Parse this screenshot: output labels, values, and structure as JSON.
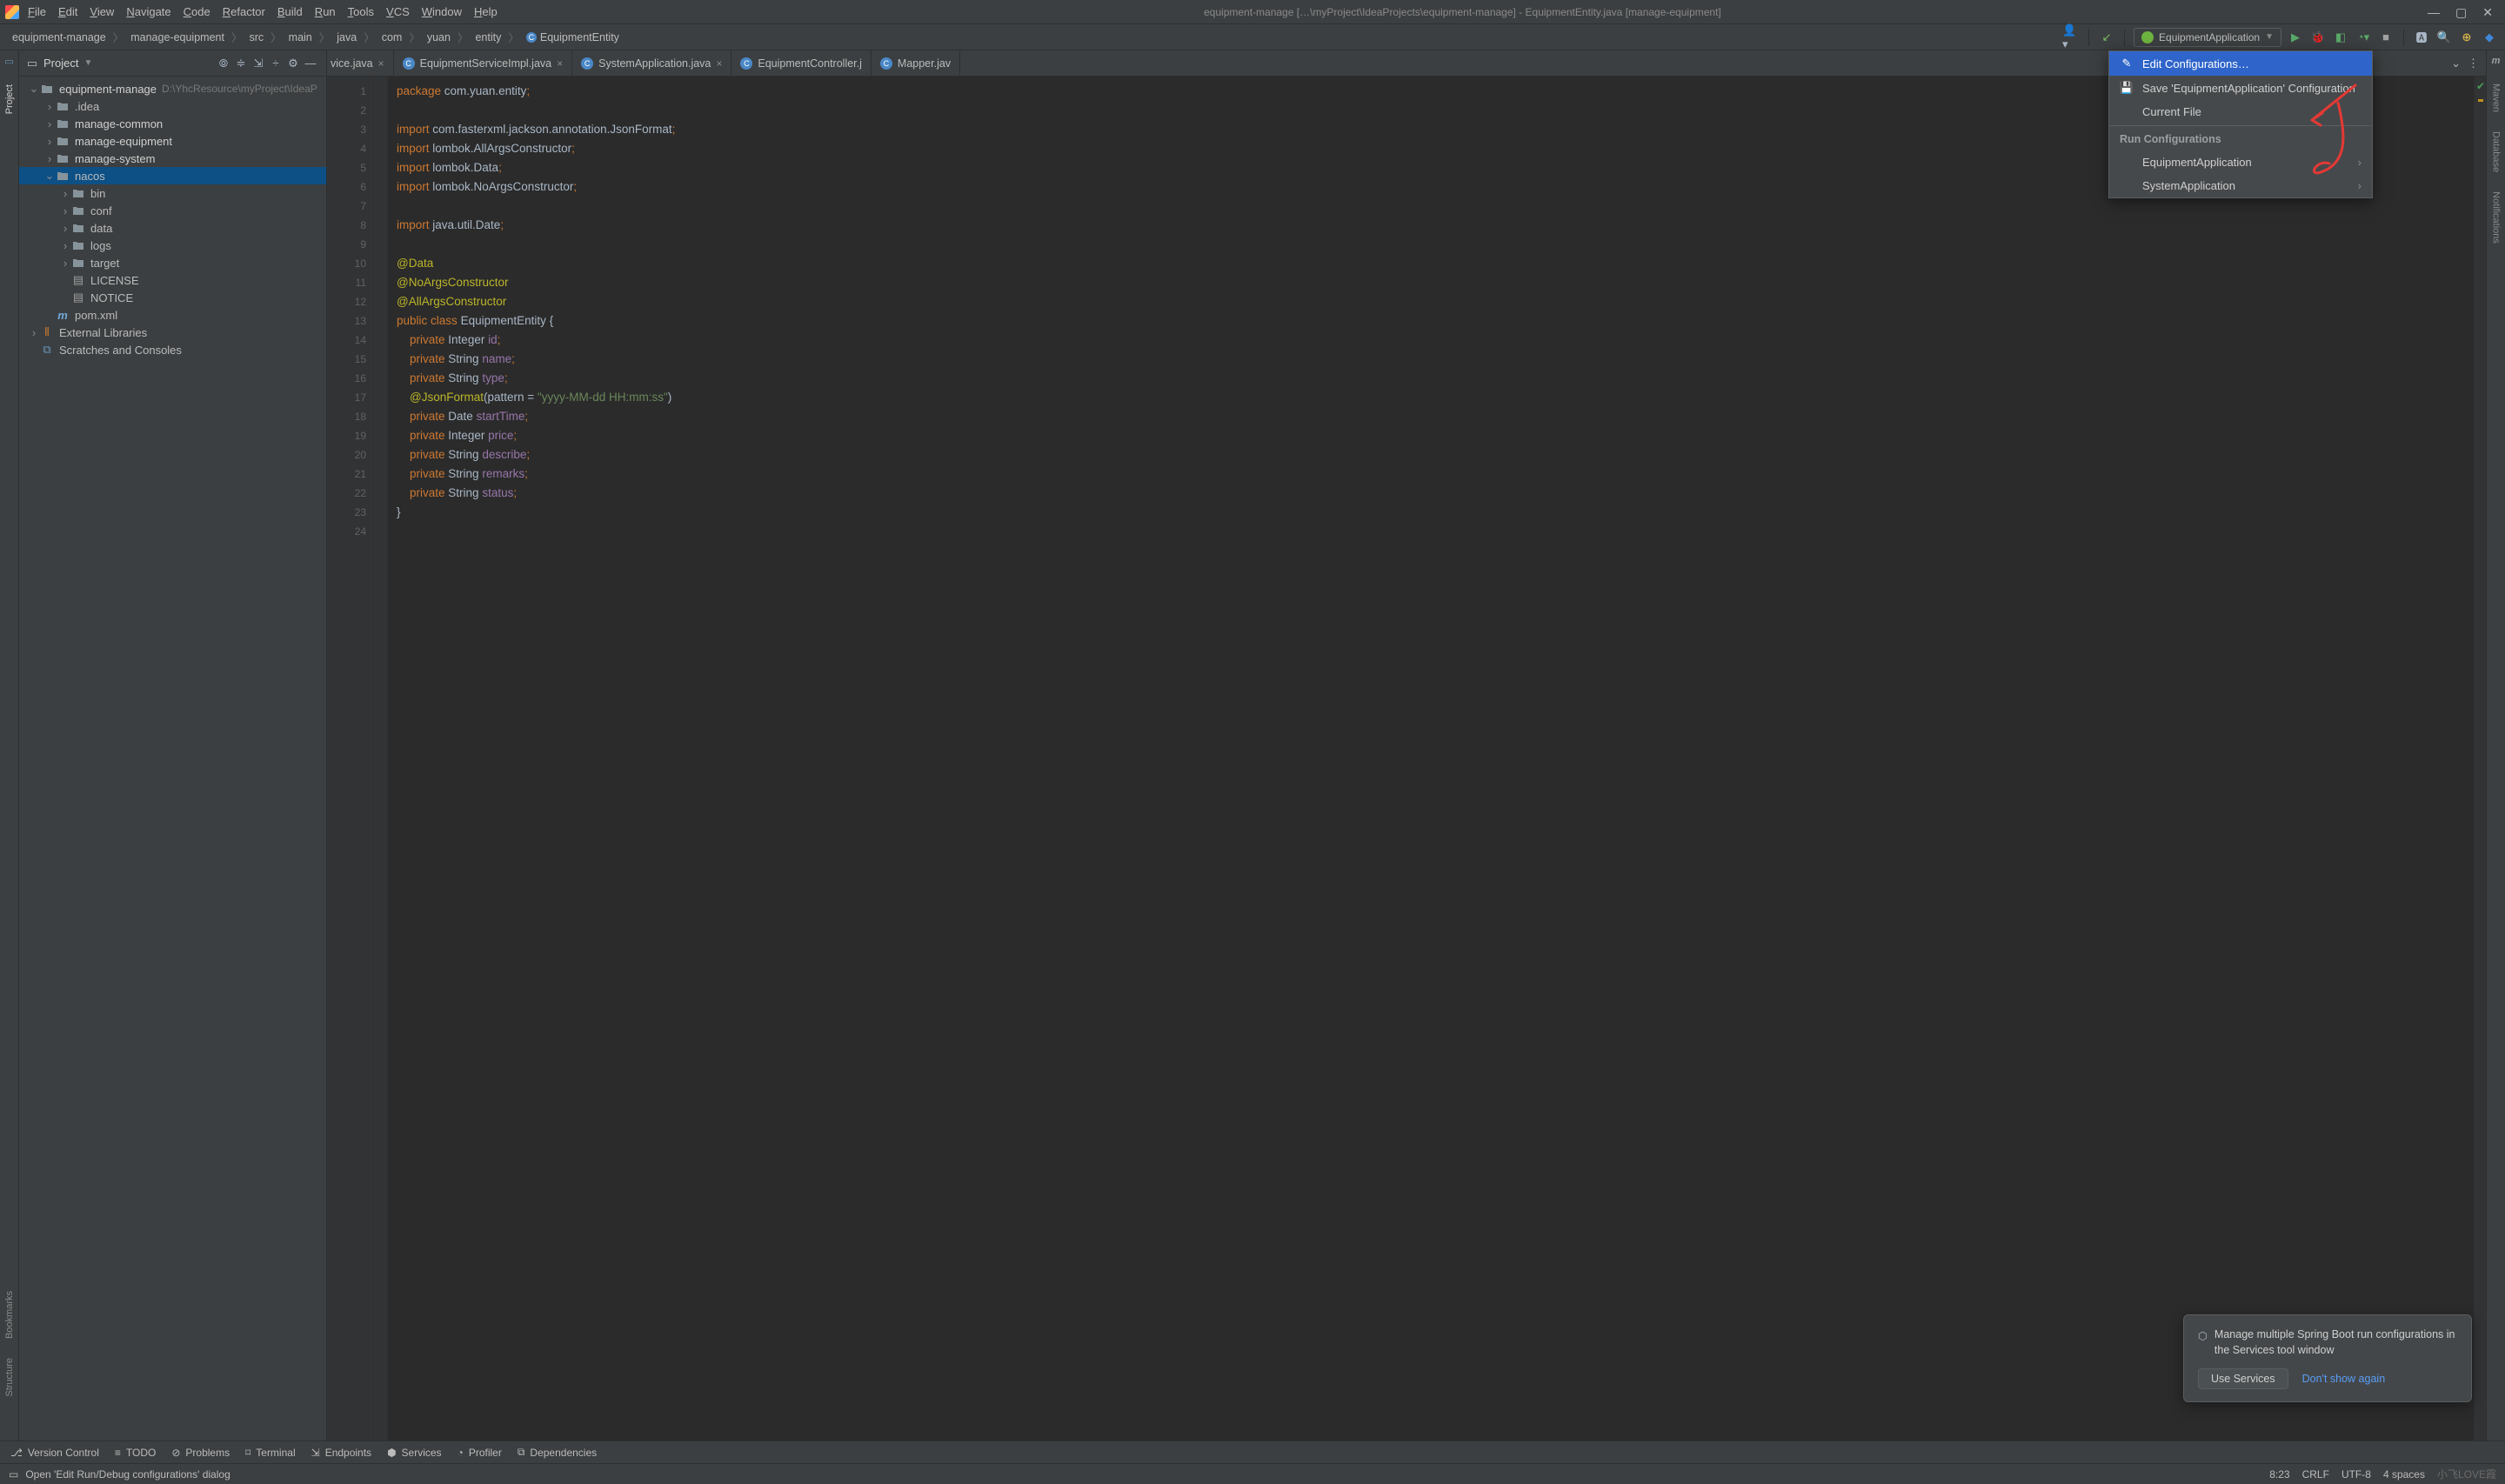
{
  "window": {
    "title": "equipment-manage […\\myProject\\IdeaProjects\\equipment-manage] - EquipmentEntity.java [manage-equipment]"
  },
  "menu": [
    "File",
    "Edit",
    "View",
    "Navigate",
    "Code",
    "Refactor",
    "Build",
    "Run",
    "Tools",
    "VCS",
    "Window",
    "Help"
  ],
  "breadcrumbs": [
    "equipment-manage",
    "manage-equipment",
    "src",
    "main",
    "java",
    "com",
    "yuan",
    "entity",
    "EquipmentEntity"
  ],
  "run_config": {
    "selected": "EquipmentApplication",
    "popup": {
      "edit": "Edit Configurations…",
      "save": "Save 'EquipmentApplication' Configuration",
      "current_file": "Current File",
      "header": "Run Configurations",
      "items": [
        "EquipmentApplication",
        "SystemApplication"
      ]
    }
  },
  "project": {
    "title": "Project",
    "root": {
      "name": "equipment-manage",
      "path": "D:\\YhcResource\\myProject\\IdeaP"
    },
    "children": [
      {
        "name": ".idea",
        "type": "folder",
        "arrow": ">"
      },
      {
        "name": "manage-common",
        "type": "module",
        "arrow": ">",
        "bold": true
      },
      {
        "name": "manage-equipment",
        "type": "module",
        "arrow": ">",
        "bold": true
      },
      {
        "name": "manage-system",
        "type": "module",
        "arrow": ">",
        "bold": true
      },
      {
        "name": "nacos",
        "type": "folder",
        "arrow": "v",
        "selected": true,
        "children": [
          {
            "name": "bin",
            "type": "folder",
            "arrow": ">"
          },
          {
            "name": "conf",
            "type": "folder",
            "arrow": ">"
          },
          {
            "name": "data",
            "type": "folder",
            "arrow": ">"
          },
          {
            "name": "logs",
            "type": "folder",
            "arrow": ">"
          },
          {
            "name": "target",
            "type": "folder",
            "arrow": ">"
          },
          {
            "name": "LICENSE",
            "type": "file"
          },
          {
            "name": "NOTICE",
            "type": "file"
          }
        ]
      },
      {
        "name": "pom.xml",
        "type": "mfile"
      }
    ],
    "extras": [
      "External Libraries",
      "Scratches and Consoles"
    ]
  },
  "tabs": [
    {
      "label": "vice.java",
      "partial": true
    },
    {
      "label": "EquipmentServiceImpl.java"
    },
    {
      "label": "SystemApplication.java"
    },
    {
      "label": "EquipmentController.j",
      "partial_right": true
    },
    {
      "label": "Mapper.jav",
      "partial_right": true
    }
  ],
  "code_lines": [
    {
      "n": 1,
      "html": "<span class='kw'>package</span> com.yuan.entity<span class='semi'>;</span>"
    },
    {
      "n": 2,
      "html": ""
    },
    {
      "n": 3,
      "html": "<span class='kw'>import</span> com.fasterxml.jackson.annotation.JsonFormat<span class='semi'>;</span>"
    },
    {
      "n": 4,
      "html": "<span class='kw'>import</span> lombok.AllArgsConstructor<span class='semi'>;</span>"
    },
    {
      "n": 5,
      "html": "<span class='kw'>import</span> lombok.Data<span class='semi'>;</span>"
    },
    {
      "n": 6,
      "html": "<span class='kw'>import</span> lombok.NoArgsConstructor<span class='semi'>;</span>"
    },
    {
      "n": 7,
      "html": ""
    },
    {
      "n": 8,
      "html": "<span class='kw'>import</span> java.util.Date<span class='semi'>;</span>"
    },
    {
      "n": 9,
      "html": ""
    },
    {
      "n": 10,
      "html": "<span class='ann'>@Data</span>"
    },
    {
      "n": 11,
      "html": "<span class='ann'>@NoArgsConstructor</span>"
    },
    {
      "n": 12,
      "html": "<span class='ann'>@AllArgsConstructor</span>"
    },
    {
      "n": 13,
      "html": "<span class='kw'>public</span> <span class='kw'>class</span> EquipmentEntity {"
    },
    {
      "n": 14,
      "html": "    <span class='kw'>private</span> Integer <span class='fld'>id</span><span class='semi'>;</span>"
    },
    {
      "n": 15,
      "html": "    <span class='kw'>private</span> String <span class='fld'>name</span><span class='semi'>;</span>"
    },
    {
      "n": 16,
      "html": "    <span class='kw'>private</span> String <span class='fld'>type</span><span class='semi'>;</span>"
    },
    {
      "n": 17,
      "html": "    <span class='ann'>@JsonFormat</span>(pattern = <span class='str'>\"yyyy-MM-dd HH:mm:ss\"</span>)"
    },
    {
      "n": 18,
      "html": "    <span class='kw'>private</span> Date <span class='fld'>startTime</span><span class='semi'>;</span>"
    },
    {
      "n": 19,
      "html": "    <span class='kw'>private</span> Integer <span class='fld'>price</span><span class='semi'>;</span>"
    },
    {
      "n": 20,
      "html": "    <span class='kw'>private</span> String <span class='fld'>describe</span><span class='semi'>;</span>"
    },
    {
      "n": 21,
      "html": "    <span class='kw'>private</span> String <span class='fld'>remarks</span><span class='semi'>;</span>"
    },
    {
      "n": 22,
      "html": "    <span class='kw'>private</span> String <span class='fld'>status</span><span class='semi'>;</span>"
    },
    {
      "n": 23,
      "html": "}"
    },
    {
      "n": 24,
      "html": ""
    }
  ],
  "left_stripe": [
    "Project",
    "Bookmarks",
    "Structure"
  ],
  "right_stripe": [
    "Maven",
    "Database",
    "Notifications"
  ],
  "right_stripe_m": "m",
  "bottom_tools": [
    "Version Control",
    "TODO",
    "Problems",
    "Terminal",
    "Endpoints",
    "Services",
    "Profiler",
    "Dependencies"
  ],
  "notification": {
    "text": "Manage multiple Spring Boot run configurations in the Services tool window",
    "btn": "Use Services",
    "link": "Don't show again"
  },
  "status": {
    "left": "Open 'Edit Run/Debug configurations' dialog",
    "pos": "8:23",
    "sep": "CRLF",
    "enc": "UTF-8",
    "indent": "4 spaces"
  }
}
